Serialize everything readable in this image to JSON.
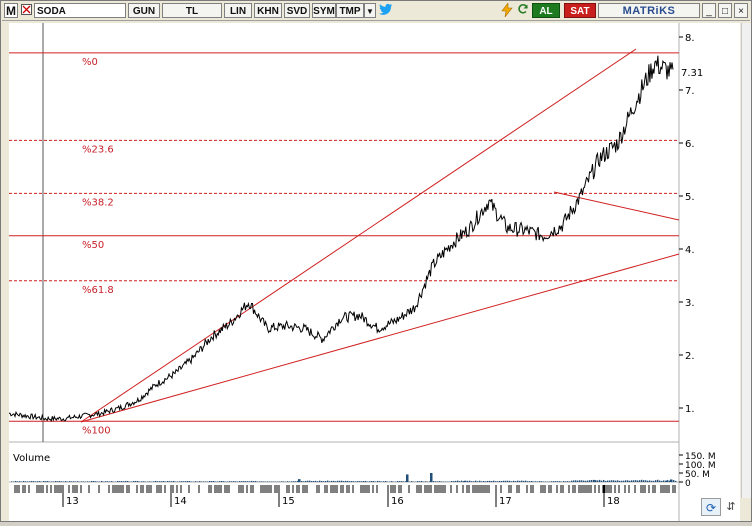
{
  "toolbar": {
    "logo": "M",
    "symbol": "SODA",
    "period": "GUN",
    "currency": "TL",
    "scale_lin": "LIN",
    "khn": "KHN",
    "svd": "SVD",
    "sym": "SYM",
    "tmp": "TMP",
    "buy": "AL",
    "sell": "SAT",
    "brand": "MATRiKS",
    "win_minimize": "_",
    "win_maximize": "□",
    "win_close": "×",
    "icons": [
      "chevron-down-icon",
      "twitter-icon",
      "lightning-icon",
      "refresh-icon"
    ]
  },
  "fibonacci": {
    "levels": [
      {
        "label": "%0",
        "price": 7.7,
        "style": "solid"
      },
      {
        "label": "%23.6",
        "price": 6.05,
        "style": "dashed"
      },
      {
        "label": "%38.2",
        "price": 5.05,
        "style": "dashed"
      },
      {
        "label": "%50",
        "price": 4.25,
        "style": "solid"
      },
      {
        "label": "%61.8",
        "price": 3.4,
        "style": "dashed"
      },
      {
        "label": "%100",
        "price": 0.75,
        "style": "solid"
      }
    ]
  },
  "price_axis": {
    "ticks": [
      "8.",
      "7.",
      "6.",
      "5.",
      "4.",
      "3.",
      "2.",
      "1."
    ],
    "current_value": "7.31"
  },
  "volume": {
    "label": "Volume",
    "ticks": [
      "150. M",
      "100. M",
      "50. M",
      "0"
    ]
  },
  "date_axis": {
    "labels": [
      "13",
      "14",
      "15",
      "16",
      "17",
      "18"
    ]
  },
  "colors": {
    "fib_line": "#d02020",
    "fib_label": "#c8202a",
    "price_series": "#000000",
    "volume_bar": "#1f4e79",
    "buy_bg": "#1e7a1e",
    "sell_bg": "#c81e1e",
    "brand": "#2a4d8f"
  },
  "chart_data": {
    "type": "line",
    "ylim": [
      0.5,
      8.0
    ],
    "x": [
      "2012-09",
      "2012-12",
      "2013-02",
      "2013-04",
      "2013-07",
      "2013-10",
      "2014-01",
      "2014-03",
      "2014-05",
      "2014-07",
      "2014-10",
      "2015-01",
      "2015-03",
      "2015-04",
      "2015-06",
      "2015-08",
      "2015-10",
      "2015-12",
      "2016-01",
      "2016-04",
      "2016-07",
      "2016-10",
      "2016-12",
      "2017-02",
      "2017-04",
      "2017-06",
      "2017-08",
      "2017-10",
      "2017-12",
      "2018-01",
      "2018-03",
      "2018-04",
      "2018-05",
      "2018-06",
      "2018-07",
      "2018-08",
      "2018-09"
    ],
    "series": [
      {
        "values": [
          0.9,
          0.85,
          0.8,
          0.8,
          0.85,
          0.9,
          1.0,
          1.15,
          1.45,
          1.65,
          1.95,
          2.35,
          2.6,
          3.0,
          2.5,
          2.55,
          2.5,
          2.3,
          2.7,
          2.75,
          2.5,
          2.65,
          2.9,
          3.7,
          4.1,
          4.4,
          4.9,
          4.4,
          4.35,
          4.25,
          4.45,
          5.0,
          5.7,
          6.0,
          6.8,
          7.5,
          7.31
        ]
      }
    ],
    "volume": [
      2,
      3,
      2,
      3,
      5,
      20,
      4,
      3,
      4,
      6,
      45,
      50,
      5,
      6,
      10,
      12,
      20
    ]
  }
}
